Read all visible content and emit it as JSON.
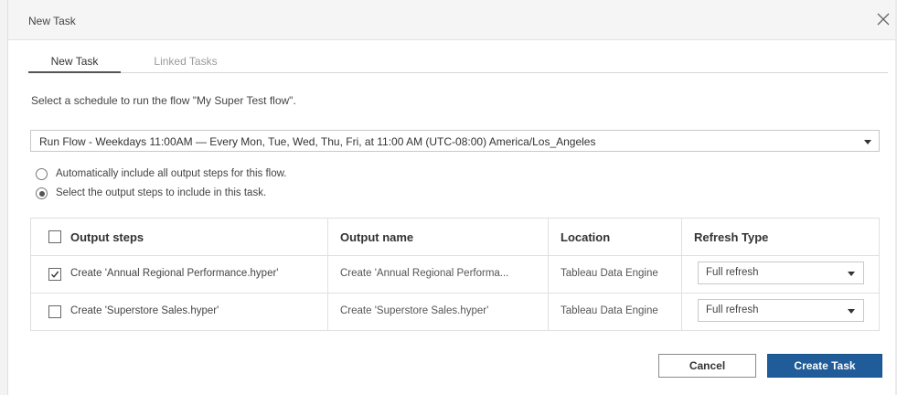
{
  "dialog": {
    "title": "New Task"
  },
  "tabs": [
    {
      "label": "New Task",
      "active": true
    },
    {
      "label": "Linked Tasks",
      "active": false
    }
  ],
  "prompt": "Select a schedule to run the flow \"My Super Test flow\".",
  "schedule": {
    "selected": "Run Flow - Weekdays 11:00AM — Every Mon, Tue, Wed, Thu, Fri, at 11:00 AM (UTC-08:00) America/Los_Angeles"
  },
  "options": [
    {
      "label": "Automatically include all output steps for this flow.",
      "selected": false
    },
    {
      "label": "Select the output steps to include in this task.",
      "selected": true
    }
  ],
  "table": {
    "headers": {
      "output_steps": "Output steps",
      "output_name": "Output name",
      "location": "Location",
      "refresh_type": "Refresh Type"
    },
    "rows": [
      {
        "checked": true,
        "step": "Create 'Annual Regional Performance.hyper'",
        "name": "Create 'Annual Regional Performa...",
        "location": "Tableau Data Engine",
        "refresh": "Full refresh"
      },
      {
        "checked": false,
        "step": "Create 'Superstore Sales.hyper'",
        "name": "Create 'Superstore Sales.hyper'",
        "location": "Tableau Data Engine",
        "refresh": "Full refresh"
      }
    ]
  },
  "buttons": {
    "cancel": "Cancel",
    "create": "Create Task"
  },
  "colors": {
    "primary": "#1f5c99",
    "header_bg": "#f5f5f5",
    "border": "#e0e0e0"
  }
}
